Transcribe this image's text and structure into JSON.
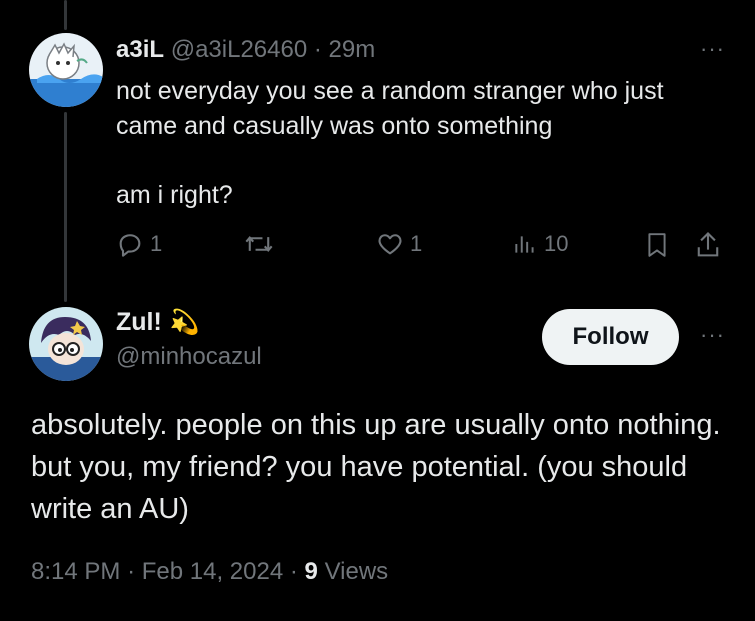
{
  "reply": {
    "display_name": "a3iL",
    "handle": "@a3iL26460",
    "separator": "·",
    "time": "29m",
    "more": "···",
    "text_line1": "not everyday you see a random stranger who just came and casually was onto something",
    "text_line2": "am i right?",
    "actions": {
      "replies": "1",
      "likes": "1",
      "views": "10"
    }
  },
  "main": {
    "display_name": "Zul!",
    "name_emoji": "💫",
    "handle": "@minhocazul",
    "follow_label": "Follow",
    "more": "···",
    "text": "absolutely. people on this up are usually onto nothing. but you, my friend? you have potential. (you should write an AU)",
    "time": "8:14 PM",
    "separator": "·",
    "date": "Feb 14, 2024",
    "views_count": "9",
    "views_label": "Views"
  }
}
